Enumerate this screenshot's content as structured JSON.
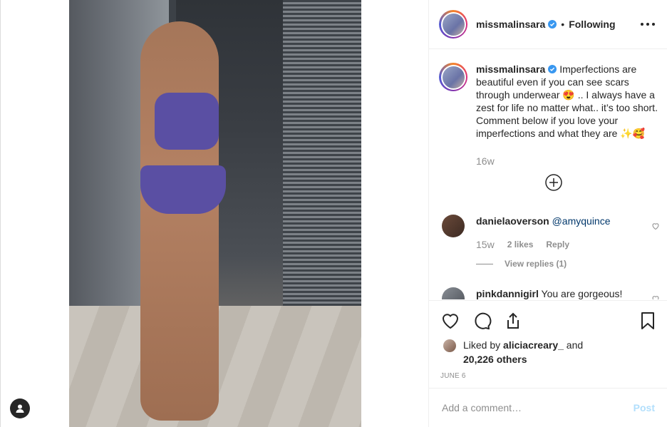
{
  "post": {
    "username": "missmalinsara",
    "separator": "•",
    "follow_status": "Following",
    "caption": "Imperfections are beautiful even if you can see scars through underwear 😍 .. I always have a zest for life no matter what.. it’s too short. Comment below if you love your imperfections and what they are ✨🥰",
    "caption_time": "16w"
  },
  "comments": [
    {
      "username": "danielaoverson",
      "text": "@amyquince",
      "time": "15w",
      "likes": "2 likes",
      "reply_label": "Reply",
      "view_replies": "View replies (1)"
    },
    {
      "username": "pinkdannigirl",
      "text": "You are gorgeous!"
    }
  ],
  "likes": {
    "prefix": "Liked by",
    "user": "aliciacreary_",
    "conjunction": "and",
    "others": "20,226 others"
  },
  "date": "JUNE 6",
  "comment_box": {
    "placeholder": "Add a comment…",
    "post_label": "Post"
  },
  "colors": {
    "text": "#262626",
    "muted": "#8e8e8e",
    "verified": "#3897f0",
    "post_disabled": "#b2dffc",
    "mention": "#00376b"
  }
}
